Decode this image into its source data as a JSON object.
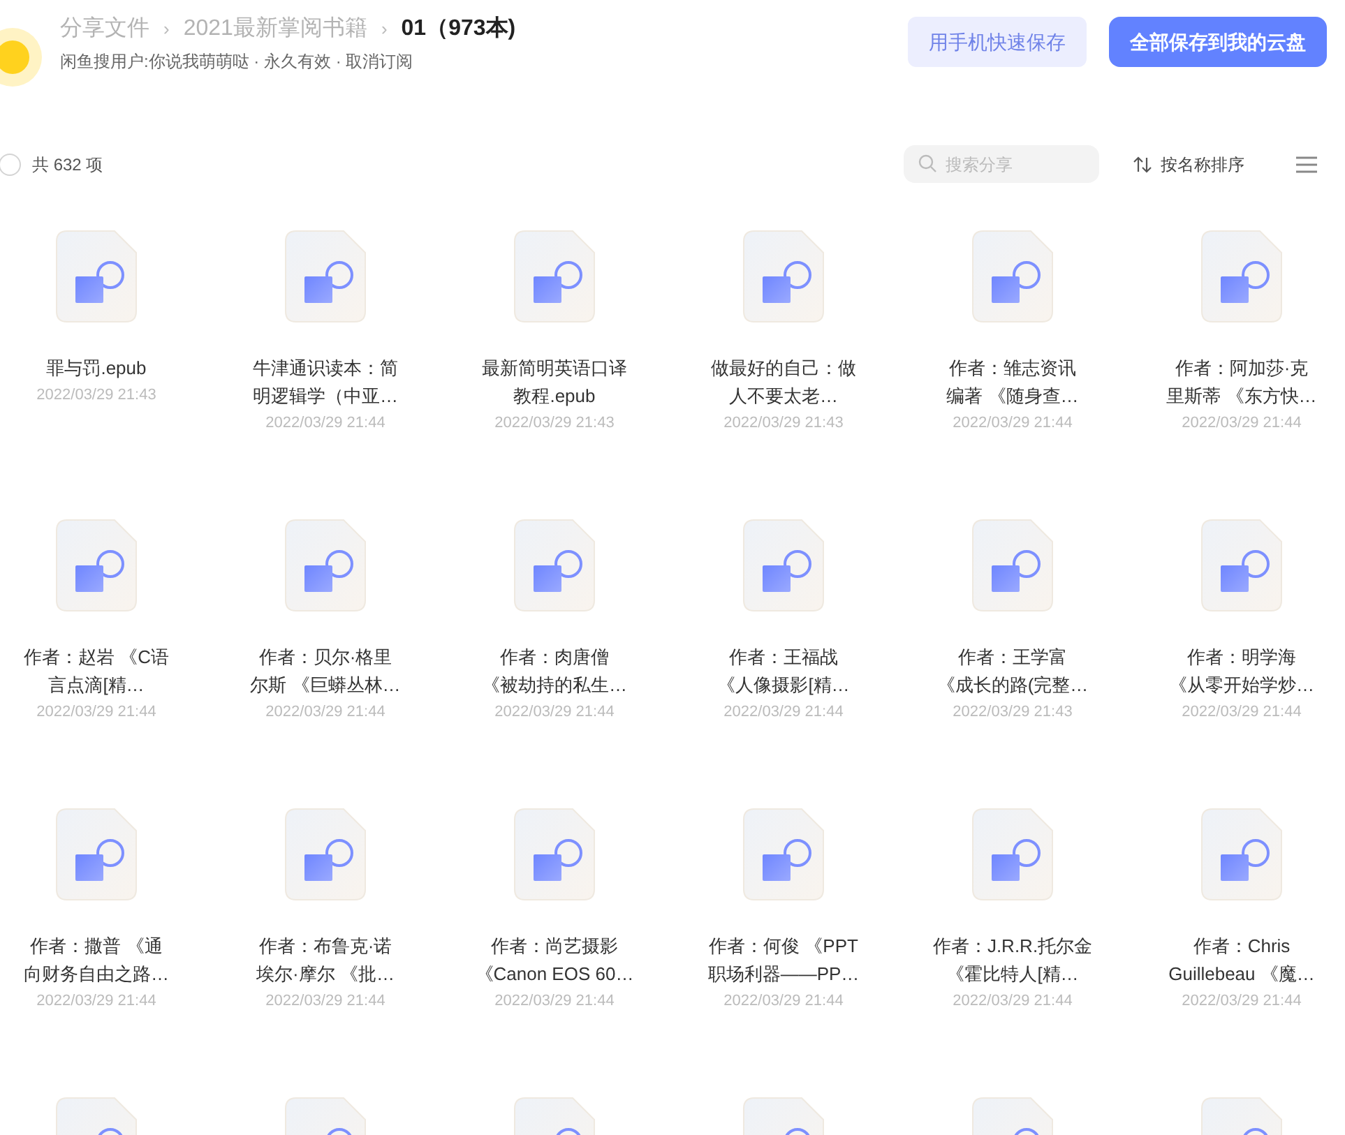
{
  "breadcrumb": [
    {
      "label": "分享文件",
      "current": false
    },
    {
      "label": "2021最新掌阅书籍",
      "current": false
    },
    {
      "label": "01（973本)",
      "current": true
    }
  ],
  "separator": "›",
  "subtitle": "闲鱼搜用户:你说我萌萌哒 · 永久有效 · 取消订阅",
  "buttons": [
    {
      "label": "用手机快速保存",
      "kind": "secondary"
    },
    {
      "label": "全部保存到我的云盘",
      "kind": "primary"
    }
  ],
  "select_all": {
    "checked": false,
    "label": "共 632 项"
  },
  "search": {
    "placeholder": "搜索分享"
  },
  "sort": {
    "label": "按名称排序"
  },
  "files": [
    {
      "lines": [
        "罪与罚.epub"
      ],
      "date": "2022/03/29 21:43"
    },
    {
      "lines": [
        "牛津通识读本：简",
        "明逻辑学（中亚…"
      ],
      "date": "2022/03/29 21:44"
    },
    {
      "lines": [
        "最新简明英语口译",
        "教程.epub"
      ],
      "date": "2022/03/29 21:43"
    },
    {
      "lines": [
        "做最好的自己：做",
        "人不要太老…"
      ],
      "date": "2022/03/29 21:43"
    },
    {
      "lines": [
        "作者：雏志资讯",
        "编著 《随身查…"
      ],
      "date": "2022/03/29 21:44"
    },
    {
      "lines": [
        "作者：阿加莎·克",
        "里斯蒂 《东方快…"
      ],
      "date": "2022/03/29 21:44"
    },
    {
      "lines": [
        "作者：赵岩 《C语",
        "言点滴[精…"
      ],
      "date": "2022/03/29 21:44"
    },
    {
      "lines": [
        "作者：贝尔·格里",
        "尔斯 《巨蟒丛林…"
      ],
      "date": "2022/03/29 21:44"
    },
    {
      "lines": [
        "作者：肉唐僧",
        "《被劫持的私生…"
      ],
      "date": "2022/03/29 21:44"
    },
    {
      "lines": [
        "作者：王福战",
        "《人像摄影[精…"
      ],
      "date": "2022/03/29 21:44"
    },
    {
      "lines": [
        "作者：王学富",
        "《成长的路(完整…"
      ],
      "date": "2022/03/29 21:43"
    },
    {
      "lines": [
        "作者：明学海",
        "《从零开始学炒…"
      ],
      "date": "2022/03/29 21:44"
    },
    {
      "lines": [
        "作者：撒普 《通",
        "向财务自由之路…"
      ],
      "date": "2022/03/29 21:44"
    },
    {
      "lines": [
        "作者：布鲁克·诺",
        "埃尔·摩尔 《批…"
      ],
      "date": "2022/03/29 21:44"
    },
    {
      "lines": [
        "作者：尚艺摄影",
        "《Canon EOS 60…"
      ],
      "date": "2022/03/29 21:44"
    },
    {
      "lines": [
        "作者：何俊 《PPT",
        "职场利器——PP…"
      ],
      "date": "2022/03/29 21:44"
    },
    {
      "lines": [
        "作者：J.R.R.托尔金",
        "《霍比特人[精…"
      ],
      "date": "2022/03/29 21:44"
    },
    {
      "lines": [
        "作者：Chris",
        "Guillebeau 《魔…"
      ],
      "date": "2022/03/29 21:44"
    }
  ]
}
